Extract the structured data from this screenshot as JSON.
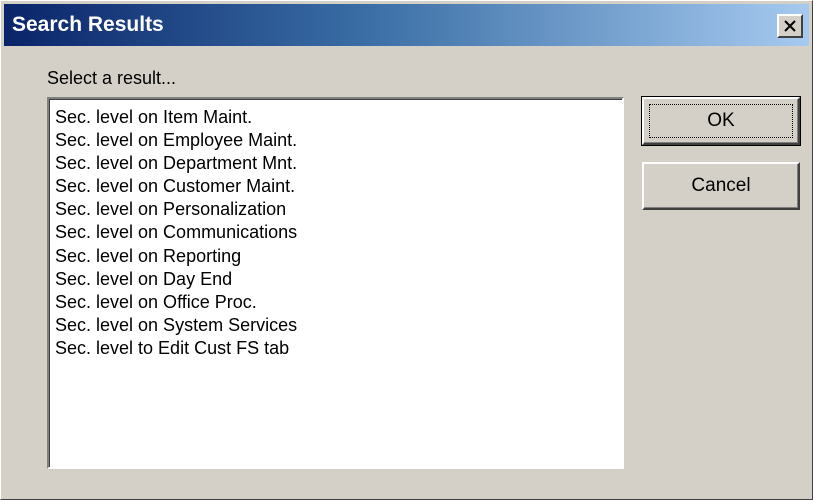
{
  "window": {
    "title": "Search Results",
    "close_icon": "close-icon"
  },
  "prompt": "Select a result...",
  "results": [
    "Sec. level on Item Maint.",
    "Sec. level on Employee Maint.",
    "Sec. level on Department Mnt.",
    "Sec. level on Customer Maint.",
    "Sec. level on Personalization",
    "Sec. level on Communications",
    "Sec. level on Reporting",
    "Sec. level on Day End",
    "Sec. level on Office Proc.",
    "Sec. level on System Services",
    "Sec. level to Edit Cust FS tab"
  ],
  "buttons": {
    "ok_label": "OK",
    "cancel_label": "Cancel"
  },
  "colors": {
    "titlebar_start": "#0a246a",
    "titlebar_end": "#a6caf0",
    "face": "#d4d0c8"
  }
}
